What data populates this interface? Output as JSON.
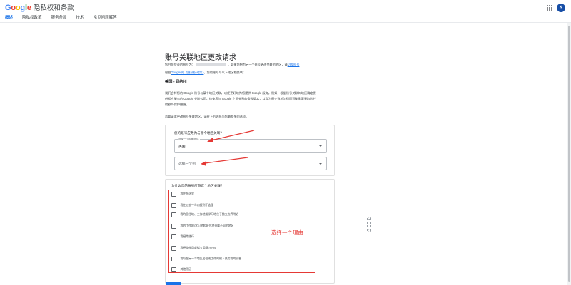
{
  "header": {
    "logo": {
      "c1": "G",
      "c2": "o",
      "c3": "o",
      "c4": "g",
      "c5": "l",
      "c6": "e"
    },
    "title": "隐私权和条款",
    "tabs": [
      "概述",
      "隐私权政策",
      "服务条款",
      "技术",
      "常见问题解答"
    ],
    "active_tab": 0,
    "avatar_letter": "K"
  },
  "main": {
    "title": "账号关联地区更改请求",
    "intro_1_start": "您目前登录的账号为：",
    "intro_1_end": "，如果您想为另一个账号更改关联的地区，请",
    "intro_1_link": "切换账号",
    "intro_2_start": "根据",
    "intro_2_link": "Google 的《隐私权政策》",
    "intro_2_end": "，您的账号与以下地区相关联：",
    "region": "美国 - 纽约州",
    "para_1": "我们会将您的 Google 账号与某个地区关联，以便更好地为您提供 Google 服务。例如，根据账号关联的地区确定提",
    "para_2": "供相应服务的 Google 关联公司，约束您与 Google 之间关系的条款版本，以及为遵守当地法律而可能需要采取的任",
    "para_3": "何额外保护措施。",
    "para_4": "若要请求更改账号关联地区，请在下方选择与您最相关的选项。"
  },
  "form": {
    "country_question": "您的账号应改为与哪个地区关联？",
    "country_label": "选择一个国家/地区",
    "country_value": "美国",
    "state_placeholder": "选择一个州",
    "reason_question": "为什么您的账号应与这个地区关联？",
    "reasons": [
      "我住在这里",
      "我在过去一年内搬到了这里",
      "我的居住地、工作地或学习地位于独立边界附近",
      "我的工作地/学习地和居住地分属不同的地区",
      "我经常旅行",
      "我经常使用虚拟专用网 (VPN)",
      "我与在另一个地区居住或工作的他人共用我的设备",
      "其他原因"
    ]
  },
  "annotation": {
    "text": "选择一个理由",
    "color": "#e53935"
  },
  "colors": {
    "accent": "#1a73e8",
    "annotation": "#e53935"
  }
}
